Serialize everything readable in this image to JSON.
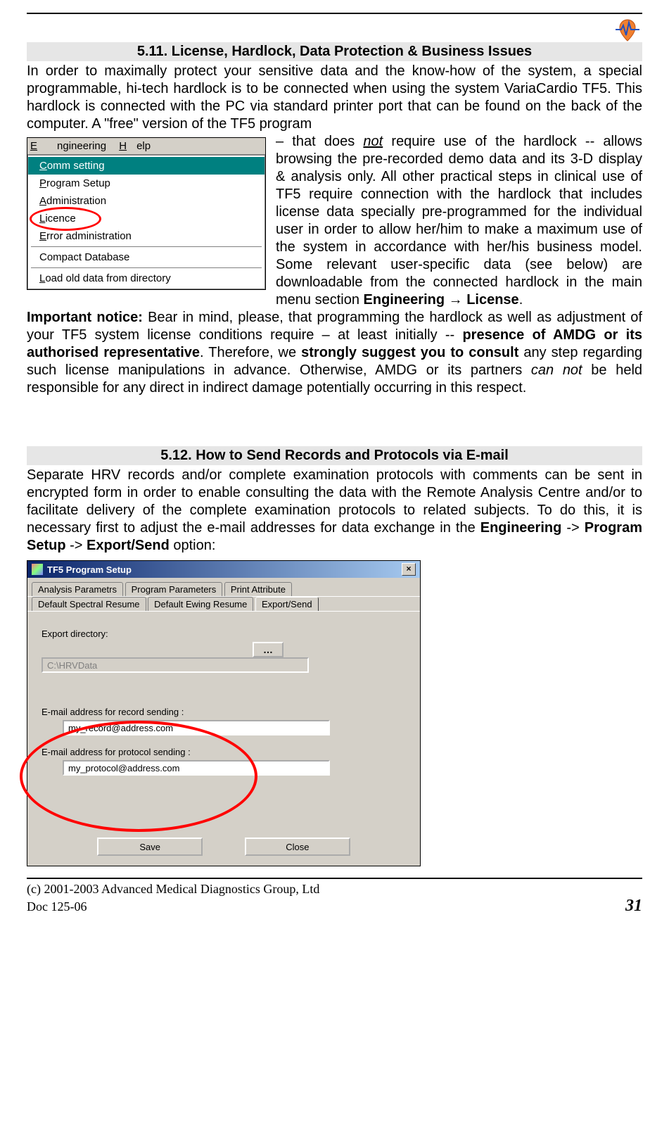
{
  "section1": {
    "heading": "5.11. License, Hardlock, Data Protection & Business Issues",
    "intro": "In order to maximally protect your sensitive data and the know-how of the system, a special programmable, hi-tech hardlock is to be connected when using the system VariaCardio TF5. This hardlock is connected with the PC via standard printer port that can be found on the back of the computer. A \"free\" version of the TF5 program ",
    "wrap_a": "– that does ",
    "wrap_not": "not",
    "wrap_b": " require use of the hardlock -- allows browsing the pre-recorded demo data and its 3-D display & analysis only. All other practical steps in clinical use of TF5 require connection with the hardlock that includes license data specially pre-programmed for the individual user in order to allow her/him to make a maximum use of the system in accordance with her/his business model. Some relevant user-specific data (see below) are downloadable from the connected hardlock in the main menu section ",
    "wrap_eng": "Engineering → License",
    "wrap_period": ".",
    "important_label": "Important notice:",
    "important_a": " Bear in mind, please, that programming the hardlock as well as adjustment of your TF5 system license conditions require – at least initially -- ",
    "important_b": "presence of AMDG or its authorised representative",
    "important_c": ". Therefore, we ",
    "important_d": "strongly suggest you to consult",
    "important_e": " any step regarding such license manipulations in advance. Otherwise, AMDG or its partners ",
    "important_f": "can not",
    "important_g": " be held responsible for any direct in indirect damage potentially occurring in this respect."
  },
  "menu1": {
    "engineering": "Engineering",
    "help": "Help",
    "items": {
      "comm": "Comm setting",
      "program_setup": "Program Setup",
      "administration": "Administration",
      "licence": "Licence",
      "error_admin": "Error administration",
      "compact": "Compact Database",
      "load_old": "Load old data from directory"
    }
  },
  "section2": {
    "heading": "5.12. How to Send Records and Protocols via E-mail",
    "para_a": "Separate HRV records and/or complete examination protocols with comments can be sent in encrypted form in order to enable consulting the data with the Remote Analysis Centre and/or to facilitate delivery of the complete examination protocols to related subjects. To do this, it is necessary first to adjust the e-mail addresses for data exchange in the ",
    "path1": "Engineering",
    "arrow": " -> ",
    "path2": "Program Setup",
    "path3": "Export/Send",
    "para_end": " option:"
  },
  "dialog": {
    "title": "TF5 Program Setup",
    "close": "×",
    "tabs": {
      "t1": "Analysis Parametrs",
      "t2": "Program Parameters",
      "t3": "Print Attribute",
      "t4": "Default Spectral Resume",
      "t5": "Default Ewing Resume",
      "t6": "Export/Send"
    },
    "export_dir_label": "Export directory:",
    "browse": "…",
    "export_dir_value": "C:\\HRVData",
    "email_record_label": "E-mail address for  record sending :",
    "email_record_value": "my_record@address.com",
    "email_protocol_label": "E-mail address for  protocol sending :",
    "email_protocol_value": "my_protocol@address.com",
    "save": "Save",
    "close_btn": "Close"
  },
  "footer": {
    "copyright": "(c) 2001-2003 Advanced Medical Diagnostics Group, Ltd",
    "doc": "Doc 125-06",
    "page": "31"
  }
}
